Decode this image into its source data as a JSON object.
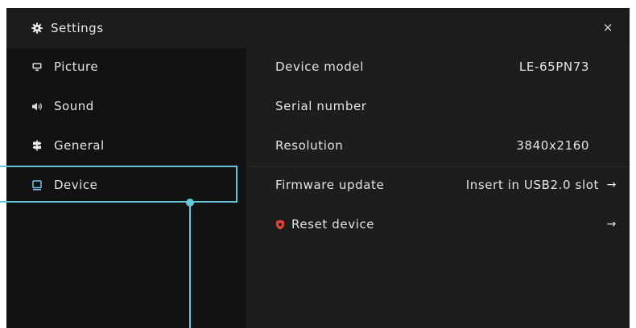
{
  "window": {
    "title": "Settings",
    "title_icon": "gear-icon",
    "close_label": "×"
  },
  "sidebar": {
    "items": [
      {
        "label": "Picture",
        "icon": "monitor-icon",
        "selected": false
      },
      {
        "label": "Sound",
        "icon": "speaker-icon",
        "selected": false
      },
      {
        "label": "General",
        "icon": "signpost-icon",
        "selected": false
      },
      {
        "label": "Device",
        "icon": "device-icon",
        "selected": true
      }
    ]
  },
  "device": {
    "rows": [
      {
        "label": "Device model",
        "value": "LE-65PN73"
      },
      {
        "label": "Serial number",
        "value": ""
      },
      {
        "label": "Resolution",
        "value": "3840x2160"
      },
      {
        "label": "Firmware update",
        "value": "Insert in USB2.0 slot",
        "arrow": "→"
      },
      {
        "label": "Reset device",
        "value": "",
        "arrow": "→",
        "icon": "shield-icon"
      }
    ]
  },
  "colors": {
    "highlight": "#66c6d8",
    "reset_icon": "#e0413a",
    "accent_device": "#7fc4e8"
  }
}
